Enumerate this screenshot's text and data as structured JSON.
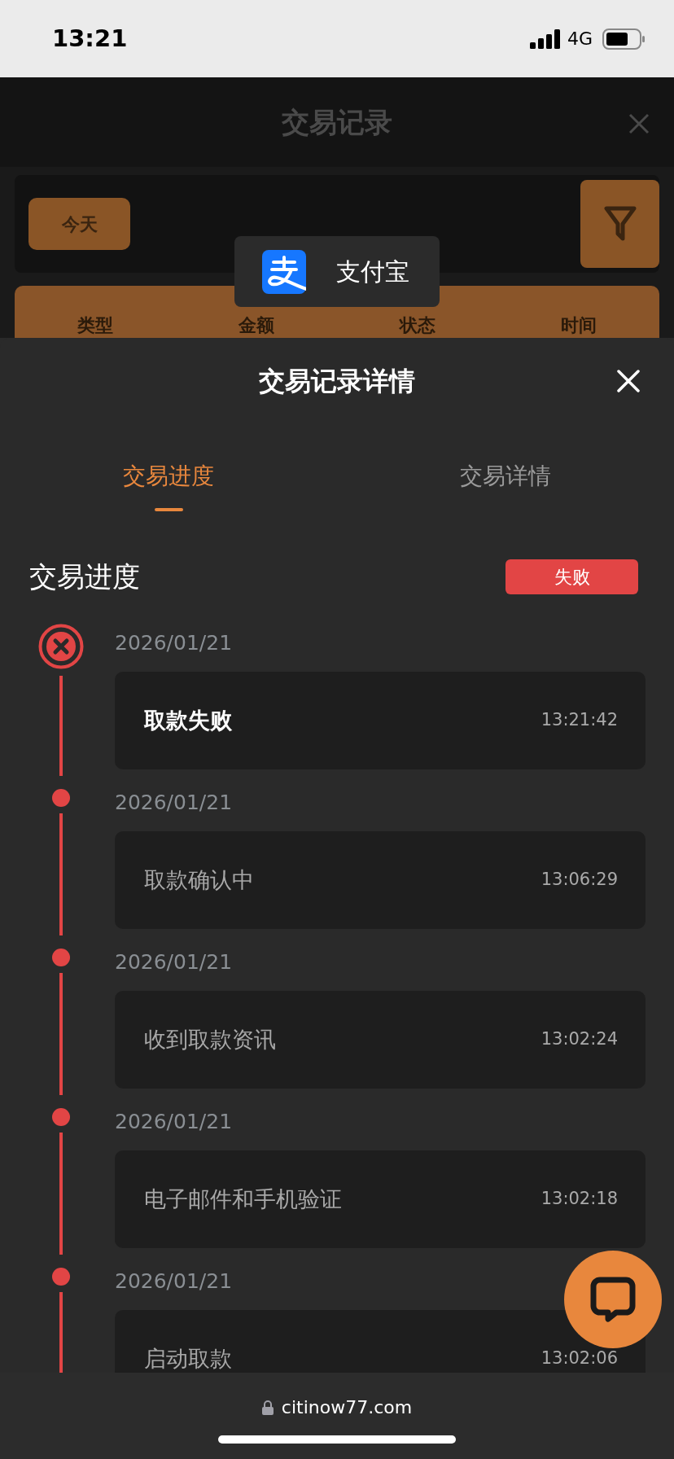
{
  "status_bar": {
    "time": "13:21",
    "network": "4G"
  },
  "background": {
    "title": "交易记录",
    "date_filter": "今天",
    "columns": [
      "类型",
      "金额",
      "状态",
      "时间"
    ]
  },
  "toast": {
    "app_name": "支付宝"
  },
  "sheet": {
    "title": "交易记录详情",
    "tabs": [
      {
        "label": "交易进度",
        "selected": true
      },
      {
        "label": "交易详情",
        "selected": false
      }
    ],
    "section_title": "交易进度",
    "status_badge": "失败",
    "timeline": [
      {
        "kind": "failed",
        "date": "2026/01/21",
        "title": "取款失败",
        "time": "13:21:42"
      },
      {
        "kind": "done",
        "date": "2026/01/21",
        "title": "取款确认中",
        "time": "13:06:29"
      },
      {
        "kind": "done",
        "date": "2026/01/21",
        "title": "收到取款资讯",
        "time": "13:02:24"
      },
      {
        "kind": "done",
        "date": "2026/01/21",
        "title": "电子邮件和手机验证",
        "time": "13:02:18"
      },
      {
        "kind": "done",
        "date": "2026/01/21",
        "title": "启动取款",
        "time": "13:02:06"
      }
    ]
  },
  "browser": {
    "url": "citinow77.com"
  }
}
